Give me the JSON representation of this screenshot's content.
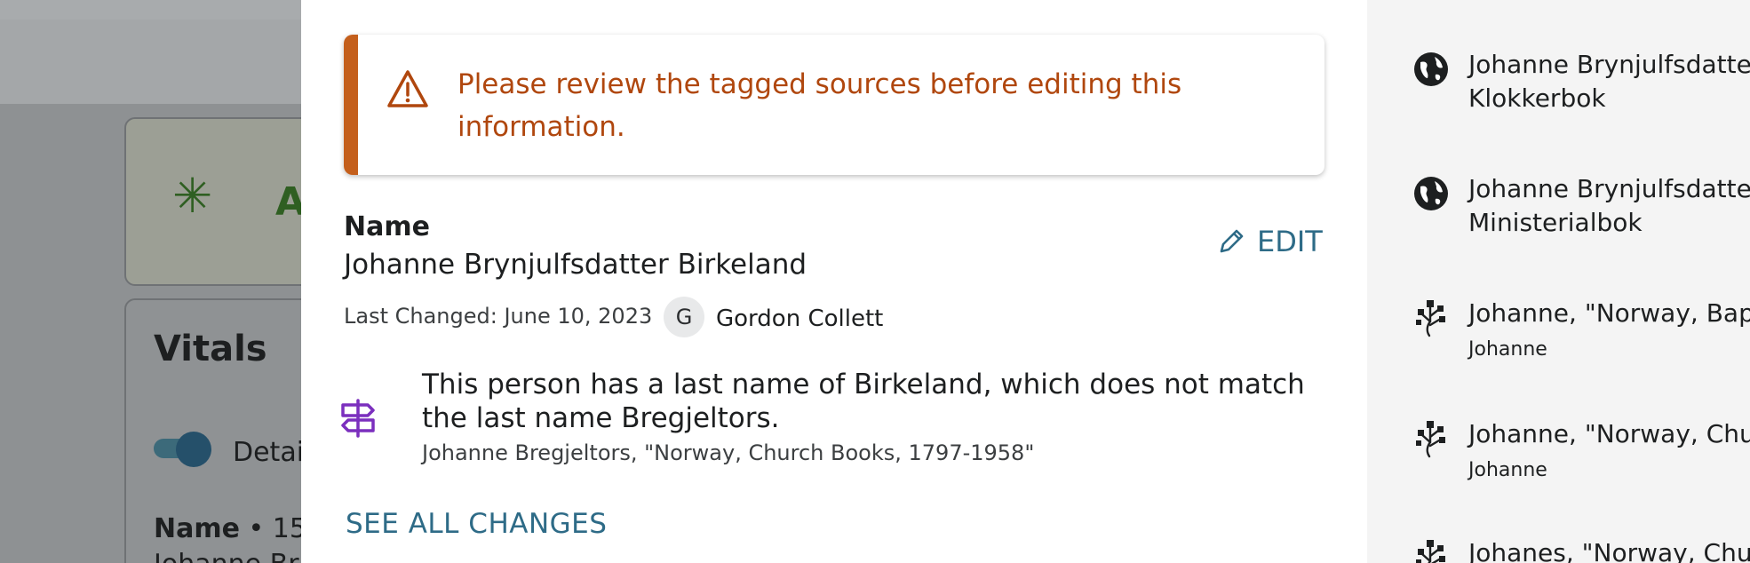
{
  "background": {
    "vitals_title": "Vitals",
    "details_label": "Detai",
    "name_label": "Name",
    "name_count": " • 15",
    "name_partial": "Johanne Br",
    "card_letter": "A"
  },
  "alert": {
    "message": "Please review the tagged sources before editing this information.",
    "icon": "warning-triangle-icon",
    "accent_color": "#c45f1c"
  },
  "field": {
    "label": "Name",
    "value": "Johanne Brynjulfsdatter Birkeland",
    "edit_label": "EDIT",
    "last_changed": "Last Changed: June 10, 2023",
    "avatar_initial": "G",
    "changed_by": "Gordon Collett"
  },
  "research_hint": {
    "icon": "signpost-icon",
    "message": "This person has a last name of Birkeland, which does not match the last name Bregjeltors.",
    "source": "Johanne Bregjeltors, \"Norway, Church Books, 1797-1958\""
  },
  "see_all_label": "SEE ALL CHANGES",
  "sources": [
    {
      "icon": "globe-icon",
      "line1": "Johanne Brynjulfsdatter",
      "line2": "Klokkerbok",
      "secondary": ""
    },
    {
      "icon": "globe-icon",
      "line1": "Johanne Brynjulfsdatter",
      "line2": "Ministerialbok",
      "secondary": ""
    },
    {
      "icon": "tree-icon",
      "line1": "Johanne, \"Norway, Bapti",
      "line2": "",
      "secondary": "Johanne"
    },
    {
      "icon": "tree-icon",
      "line1": "Johanne, \"Norway, Churc",
      "line2": "",
      "secondary": "Johanne"
    },
    {
      "icon": "tree-icon",
      "line1": "Johanes, \"Norway, Churc",
      "line2": "",
      "secondary": ""
    }
  ]
}
